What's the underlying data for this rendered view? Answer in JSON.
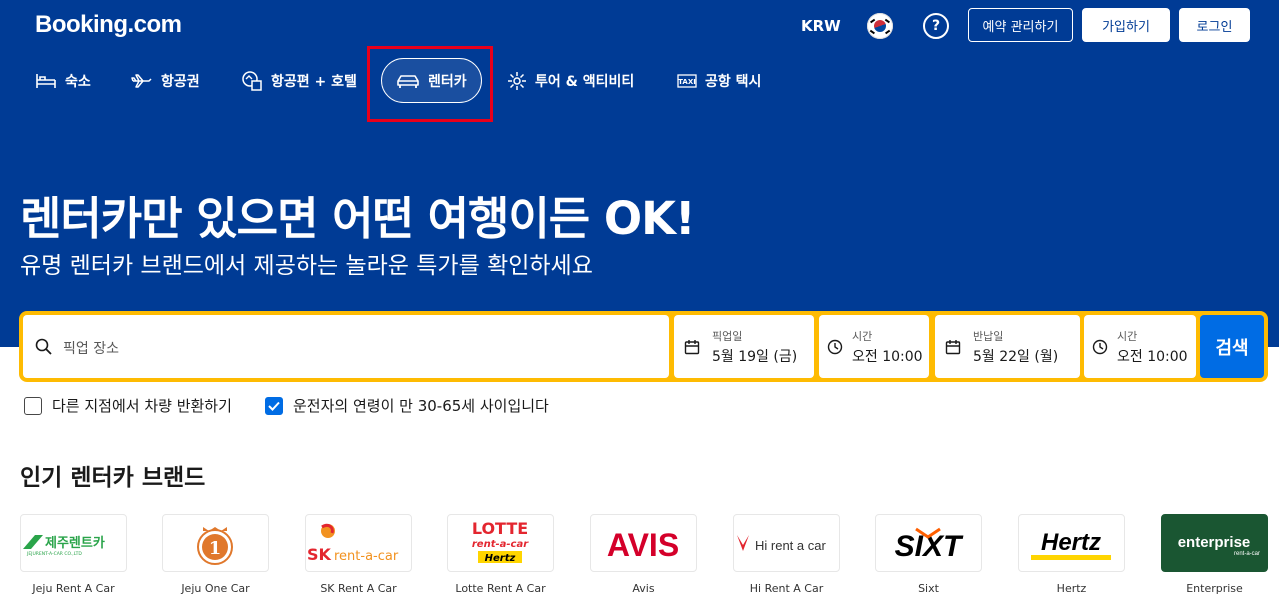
{
  "header": {
    "logo": "Booking.com",
    "currency": "KRW",
    "help": "?",
    "manage_booking": "예약 관리하기",
    "register": "가입하기",
    "signin": "로그인"
  },
  "nav": {
    "stays": "숙소",
    "flights": "항공권",
    "flight_hotel": "항공편 + 호텔",
    "car_rentals": "렌터카",
    "attractions": "투어 & 액티비티",
    "airport_taxi": "공항 택시"
  },
  "hero": {
    "headline": "렌터카만 있으면 어떤 여행이든 OK!",
    "subhead": "유명 렌터카 브랜드에서 제공하는 놀라운 특가를 확인하세요"
  },
  "search": {
    "pickup_placeholder": "픽업 장소",
    "pickup_date_label": "픽업일",
    "pickup_date": "5월 19일 (금)",
    "pickup_time_label": "시간",
    "pickup_time": "오전 10:00",
    "return_date_label": "반납일",
    "return_date": "5월 22일 (월)",
    "return_time_label": "시간",
    "return_time": "오전 10:00",
    "button": "검색"
  },
  "options": {
    "different_location": "다른 지점에서 차량 반환하기",
    "different_location_checked": false,
    "driver_age": "운전자의 연령이 만 30-65세 사이입니다",
    "driver_age_checked": true
  },
  "brands_section": {
    "title": "인기 렌터카 브랜드",
    "brands": [
      {
        "name": "Jeju Rent A Car",
        "logo_text": "제주렌트카",
        "logo_sub": "JEJURENT-A-CAR CO.,LTD"
      },
      {
        "name": "Jeju One Car",
        "logo_text": "1"
      },
      {
        "name": "SK Rent A Car",
        "logo_text": "SK",
        "logo_sub": "rent-a-car"
      },
      {
        "name": "Lotte Rent A Car",
        "logo_text": "LOTTE",
        "logo_sub": "rent-a-car",
        "logo_tag": "Hertz"
      },
      {
        "name": "Avis",
        "logo_text": "AVIS"
      },
      {
        "name": "Hi Rent A Car",
        "logo_text": "Hi rent a car"
      },
      {
        "name": "Sixt",
        "logo_text": "SIXT"
      },
      {
        "name": "Hertz",
        "logo_text": "Hertz"
      },
      {
        "name": "Enterprise",
        "logo_text": "enterprise",
        "logo_sub": "rent-a-car"
      }
    ]
  },
  "colors": {
    "brand_blue": "#003b95",
    "search_yellow": "#febb02",
    "action_blue": "#006ce4",
    "highlight_red": "#e8001a"
  },
  "icons": {
    "stays": "bed-icon",
    "flights": "plane-icon",
    "flight_hotel": "flight-hotel-icon",
    "car_rentals": "car-icon",
    "attractions": "attractions-icon",
    "airport_taxi": "taxi-icon"
  }
}
